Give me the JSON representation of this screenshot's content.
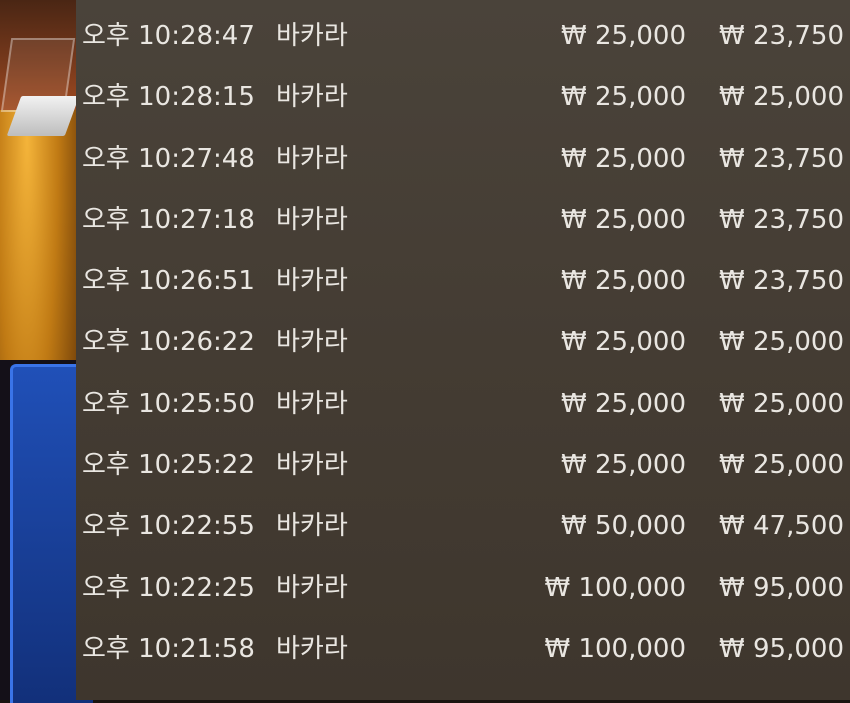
{
  "history": {
    "rows": [
      {
        "time": "오후 10:28:47",
        "game": "바카라",
        "bet": "₩ 25,000",
        "payout": "₩ 23,750"
      },
      {
        "time": "오후 10:28:15",
        "game": "바카라",
        "bet": "₩ 25,000",
        "payout": "₩ 25,000"
      },
      {
        "time": "오후 10:27:48",
        "game": "바카라",
        "bet": "₩ 25,000",
        "payout": "₩ 23,750"
      },
      {
        "time": "오후 10:27:18",
        "game": "바카라",
        "bet": "₩ 25,000",
        "payout": "₩ 23,750"
      },
      {
        "time": "오후 10:26:51",
        "game": "바카라",
        "bet": "₩ 25,000",
        "payout": "₩ 23,750"
      },
      {
        "time": "오후 10:26:22",
        "game": "바카라",
        "bet": "₩ 25,000",
        "payout": "₩ 25,000"
      },
      {
        "time": "오후 10:25:50",
        "game": "바카라",
        "bet": "₩ 25,000",
        "payout": "₩ 25,000"
      },
      {
        "time": "오후 10:25:22",
        "game": "바카라",
        "bet": "₩ 25,000",
        "payout": "₩ 25,000"
      },
      {
        "time": "오후 10:22:55",
        "game": "바카라",
        "bet": "₩ 50,000",
        "payout": "₩ 47,500"
      },
      {
        "time": "오후 10:22:25",
        "game": "바카라",
        "bet": "₩ 100,000",
        "payout": "₩ 95,000"
      },
      {
        "time": "오후 10:21:58",
        "game": "바카라",
        "bet": "₩ 100,000",
        "payout": "₩ 95,000"
      }
    ]
  },
  "colors": {
    "panel_bg": "#443c33",
    "text": "#e9e6e1",
    "table_felt": "#c07a14",
    "side_button": "#2050b8"
  }
}
